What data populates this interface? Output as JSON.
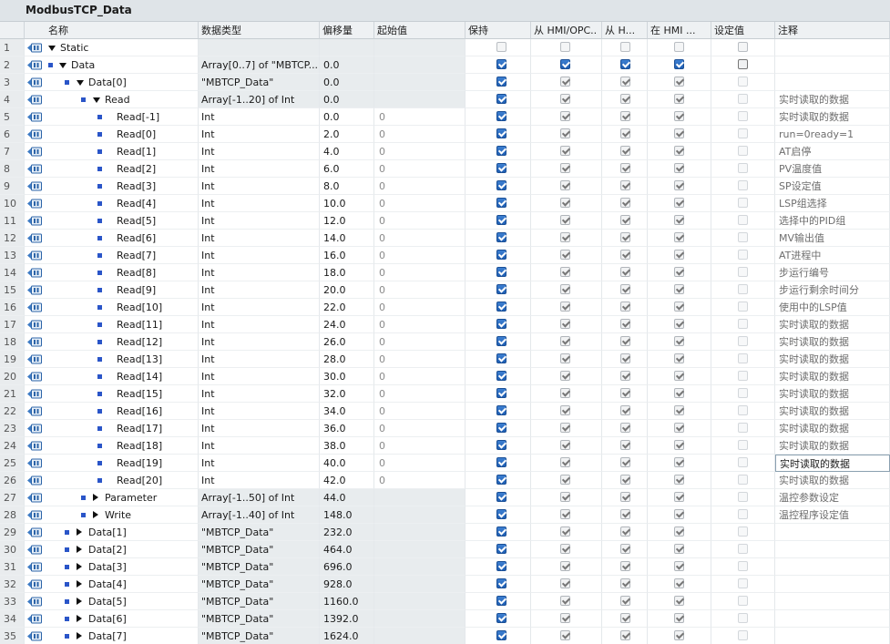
{
  "window_title": "ModbusTCP_Data",
  "headers": {
    "name": "名称",
    "type": "数据类型",
    "offset": "偏移量",
    "start": "起始值",
    "retain": "保持",
    "accessible": "从 HMI/OPC..",
    "writable": "从 H...",
    "visible": "在 HMI ...",
    "setpoint": "设定值",
    "comment": "注释"
  },
  "rows": [
    {
      "idx": "1",
      "level": 0,
      "tri": "down",
      "sq": false,
      "name": "Static",
      "type": "",
      "offset": "",
      "start": "",
      "ret": "off",
      "acc": "off",
      "wri": "off",
      "vis": "off",
      "set": "off",
      "comment": "",
      "gray": true
    },
    {
      "idx": "2",
      "level": 0,
      "tri": "down",
      "sq": true,
      "name": "Data",
      "type": "Array[0..7] of \"MBTCP...",
      "offset": "0.0",
      "start": "",
      "ret": "on",
      "acc": "on",
      "wri": "on",
      "vis": "on",
      "set": "box",
      "comment": "",
      "gray": true
    },
    {
      "idx": "3",
      "level": 1,
      "tri": "down",
      "sq": true,
      "name": "Data[0]",
      "type": "\"MBTCP_Data\"",
      "offset": "0.0",
      "start": "",
      "ret": "on",
      "acc": "grayon",
      "wri": "grayon",
      "vis": "grayon",
      "set": "dis",
      "comment": "",
      "gray": true
    },
    {
      "idx": "4",
      "level": 2,
      "tri": "down",
      "sq": true,
      "name": "Read",
      "type": "Array[-1..20] of Int",
      "offset": "0.0",
      "start": "",
      "ret": "on",
      "acc": "grayon",
      "wri": "grayon",
      "vis": "grayon",
      "set": "dis",
      "comment": "实时读取的数据",
      "gray": true
    },
    {
      "idx": "5",
      "level": 3,
      "tri": "",
      "sq": true,
      "name": "Read[-1]",
      "type": "Int",
      "offset": "0.0",
      "start": "0",
      "ret": "on",
      "acc": "grayon",
      "wri": "grayon",
      "vis": "grayon",
      "set": "dis",
      "comment": "实时读取的数据",
      "gray": false
    },
    {
      "idx": "6",
      "level": 3,
      "tri": "",
      "sq": true,
      "name": "Read[0]",
      "type": "Int",
      "offset": "2.0",
      "start": "0",
      "ret": "on",
      "acc": "grayon",
      "wri": "grayon",
      "vis": "grayon",
      "set": "dis",
      "comment": "run=0ready=1",
      "gray": false
    },
    {
      "idx": "7",
      "level": 3,
      "tri": "",
      "sq": true,
      "name": "Read[1]",
      "type": "Int",
      "offset": "4.0",
      "start": "0",
      "ret": "on",
      "acc": "grayon",
      "wri": "grayon",
      "vis": "grayon",
      "set": "dis",
      "comment": "AT启停",
      "gray": false
    },
    {
      "idx": "8",
      "level": 3,
      "tri": "",
      "sq": true,
      "name": "Read[2]",
      "type": "Int",
      "offset": "6.0",
      "start": "0",
      "ret": "on",
      "acc": "grayon",
      "wri": "grayon",
      "vis": "grayon",
      "set": "dis",
      "comment": "PV温度值",
      "gray": false
    },
    {
      "idx": "9",
      "level": 3,
      "tri": "",
      "sq": true,
      "name": "Read[3]",
      "type": "Int",
      "offset": "8.0",
      "start": "0",
      "ret": "on",
      "acc": "grayon",
      "wri": "grayon",
      "vis": "grayon",
      "set": "dis",
      "comment": "SP设定值",
      "gray": false
    },
    {
      "idx": "10",
      "level": 3,
      "tri": "",
      "sq": true,
      "name": "Read[4]",
      "type": "Int",
      "offset": "10.0",
      "start": "0",
      "ret": "on",
      "acc": "grayon",
      "wri": "grayon",
      "vis": "grayon",
      "set": "dis",
      "comment": "LSP组选择",
      "gray": false
    },
    {
      "idx": "11",
      "level": 3,
      "tri": "",
      "sq": true,
      "name": "Read[5]",
      "type": "Int",
      "offset": "12.0",
      "start": "0",
      "ret": "on",
      "acc": "grayon",
      "wri": "grayon",
      "vis": "grayon",
      "set": "dis",
      "comment": "选择中的PID组",
      "gray": false
    },
    {
      "idx": "12",
      "level": 3,
      "tri": "",
      "sq": true,
      "name": "Read[6]",
      "type": "Int",
      "offset": "14.0",
      "start": "0",
      "ret": "on",
      "acc": "grayon",
      "wri": "grayon",
      "vis": "grayon",
      "set": "dis",
      "comment": "MV输出值",
      "gray": false
    },
    {
      "idx": "13",
      "level": 3,
      "tri": "",
      "sq": true,
      "name": "Read[7]",
      "type": "Int",
      "offset": "16.0",
      "start": "0",
      "ret": "on",
      "acc": "grayon",
      "wri": "grayon",
      "vis": "grayon",
      "set": "dis",
      "comment": "AT进程中",
      "gray": false
    },
    {
      "idx": "14",
      "level": 3,
      "tri": "",
      "sq": true,
      "name": "Read[8]",
      "type": "Int",
      "offset": "18.0",
      "start": "0",
      "ret": "on",
      "acc": "grayon",
      "wri": "grayon",
      "vis": "grayon",
      "set": "dis",
      "comment": "步运行编号",
      "gray": false
    },
    {
      "idx": "15",
      "level": 3,
      "tri": "",
      "sq": true,
      "name": "Read[9]",
      "type": "Int",
      "offset": "20.0",
      "start": "0",
      "ret": "on",
      "acc": "grayon",
      "wri": "grayon",
      "vis": "grayon",
      "set": "dis",
      "comment": "步运行剩余时间分",
      "gray": false
    },
    {
      "idx": "16",
      "level": 3,
      "tri": "",
      "sq": true,
      "name": "Read[10]",
      "type": "Int",
      "offset": "22.0",
      "start": "0",
      "ret": "on",
      "acc": "grayon",
      "wri": "grayon",
      "vis": "grayon",
      "set": "dis",
      "comment": "使用中的LSP值",
      "gray": false
    },
    {
      "idx": "17",
      "level": 3,
      "tri": "",
      "sq": true,
      "name": "Read[11]",
      "type": "Int",
      "offset": "24.0",
      "start": "0",
      "ret": "on",
      "acc": "grayon",
      "wri": "grayon",
      "vis": "grayon",
      "set": "dis",
      "comment": "实时读取的数据",
      "gray": false
    },
    {
      "idx": "18",
      "level": 3,
      "tri": "",
      "sq": true,
      "name": "Read[12]",
      "type": "Int",
      "offset": "26.0",
      "start": "0",
      "ret": "on",
      "acc": "grayon",
      "wri": "grayon",
      "vis": "grayon",
      "set": "dis",
      "comment": "实时读取的数据",
      "gray": false
    },
    {
      "idx": "19",
      "level": 3,
      "tri": "",
      "sq": true,
      "name": "Read[13]",
      "type": "Int",
      "offset": "28.0",
      "start": "0",
      "ret": "on",
      "acc": "grayon",
      "wri": "grayon",
      "vis": "grayon",
      "set": "dis",
      "comment": "实时读取的数据",
      "gray": false
    },
    {
      "idx": "20",
      "level": 3,
      "tri": "",
      "sq": true,
      "name": "Read[14]",
      "type": "Int",
      "offset": "30.0",
      "start": "0",
      "ret": "on",
      "acc": "grayon",
      "wri": "grayon",
      "vis": "grayon",
      "set": "dis",
      "comment": "实时读取的数据",
      "gray": false
    },
    {
      "idx": "21",
      "level": 3,
      "tri": "",
      "sq": true,
      "name": "Read[15]",
      "type": "Int",
      "offset": "32.0",
      "start": "0",
      "ret": "on",
      "acc": "grayon",
      "wri": "grayon",
      "vis": "grayon",
      "set": "dis",
      "comment": "实时读取的数据",
      "gray": false
    },
    {
      "idx": "22",
      "level": 3,
      "tri": "",
      "sq": true,
      "name": "Read[16]",
      "type": "Int",
      "offset": "34.0",
      "start": "0",
      "ret": "on",
      "acc": "grayon",
      "wri": "grayon",
      "vis": "grayon",
      "set": "dis",
      "comment": "实时读取的数据",
      "gray": false
    },
    {
      "idx": "23",
      "level": 3,
      "tri": "",
      "sq": true,
      "name": "Read[17]",
      "type": "Int",
      "offset": "36.0",
      "start": "0",
      "ret": "on",
      "acc": "grayon",
      "wri": "grayon",
      "vis": "grayon",
      "set": "dis",
      "comment": "实时读取的数据",
      "gray": false
    },
    {
      "idx": "24",
      "level": 3,
      "tri": "",
      "sq": true,
      "name": "Read[18]",
      "type": "Int",
      "offset": "38.0",
      "start": "0",
      "ret": "on",
      "acc": "grayon",
      "wri": "grayon",
      "vis": "grayon",
      "set": "dis",
      "comment": "实时读取的数据",
      "gray": false
    },
    {
      "idx": "25",
      "level": 3,
      "tri": "",
      "sq": true,
      "name": "Read[19]",
      "type": "Int",
      "offset": "40.0",
      "start": "0",
      "ret": "on",
      "acc": "grayon",
      "wri": "grayon",
      "vis": "grayon",
      "set": "dis",
      "comment": "实时读取的数据",
      "gray": false,
      "editing": true
    },
    {
      "idx": "26",
      "level": 3,
      "tri": "",
      "sq": true,
      "name": "Read[20]",
      "type": "Int",
      "offset": "42.0",
      "start": "0",
      "ret": "on",
      "acc": "grayon",
      "wri": "grayon",
      "vis": "grayon",
      "set": "dis",
      "comment": "实时读取的数据",
      "gray": false
    },
    {
      "idx": "27",
      "level": 2,
      "tri": "right",
      "sq": true,
      "name": "Parameter",
      "type": "Array[-1..50] of Int",
      "offset": "44.0",
      "start": "",
      "ret": "on",
      "acc": "grayon",
      "wri": "grayon",
      "vis": "grayon",
      "set": "dis",
      "comment": "温控参数设定",
      "gray": true
    },
    {
      "idx": "28",
      "level": 2,
      "tri": "right",
      "sq": true,
      "name": "Write",
      "type": "Array[-1..40] of Int",
      "offset": "148.0",
      "start": "",
      "ret": "on",
      "acc": "grayon",
      "wri": "grayon",
      "vis": "grayon",
      "set": "dis",
      "comment": "温控程序设定值",
      "gray": true
    },
    {
      "idx": "29",
      "level": 1,
      "tri": "right",
      "sq": true,
      "name": "Data[1]",
      "type": "\"MBTCP_Data\"",
      "offset": "232.0",
      "start": "",
      "ret": "on",
      "acc": "grayon",
      "wri": "grayon",
      "vis": "grayon",
      "set": "dis",
      "comment": "",
      "gray": true
    },
    {
      "idx": "30",
      "level": 1,
      "tri": "right",
      "sq": true,
      "name": "Data[2]",
      "type": "\"MBTCP_Data\"",
      "offset": "464.0",
      "start": "",
      "ret": "on",
      "acc": "grayon",
      "wri": "grayon",
      "vis": "grayon",
      "set": "dis",
      "comment": "",
      "gray": true
    },
    {
      "idx": "31",
      "level": 1,
      "tri": "right",
      "sq": true,
      "name": "Data[3]",
      "type": "\"MBTCP_Data\"",
      "offset": "696.0",
      "start": "",
      "ret": "on",
      "acc": "grayon",
      "wri": "grayon",
      "vis": "grayon",
      "set": "dis",
      "comment": "",
      "gray": true
    },
    {
      "idx": "32",
      "level": 1,
      "tri": "right",
      "sq": true,
      "name": "Data[4]",
      "type": "\"MBTCP_Data\"",
      "offset": "928.0",
      "start": "",
      "ret": "on",
      "acc": "grayon",
      "wri": "grayon",
      "vis": "grayon",
      "set": "dis",
      "comment": "",
      "gray": true
    },
    {
      "idx": "33",
      "level": 1,
      "tri": "right",
      "sq": true,
      "name": "Data[5]",
      "type": "\"MBTCP_Data\"",
      "offset": "1160.0",
      "start": "",
      "ret": "on",
      "acc": "grayon",
      "wri": "grayon",
      "vis": "grayon",
      "set": "dis",
      "comment": "",
      "gray": true
    },
    {
      "idx": "34",
      "level": 1,
      "tri": "right",
      "sq": true,
      "name": "Data[6]",
      "type": "\"MBTCP_Data\"",
      "offset": "1392.0",
      "start": "",
      "ret": "on",
      "acc": "grayon",
      "wri": "grayon",
      "vis": "grayon",
      "set": "dis",
      "comment": "",
      "gray": true
    },
    {
      "idx": "35",
      "level": 1,
      "tri": "right",
      "sq": true,
      "name": "Data[7]",
      "type": "\"MBTCP_Data\"",
      "offset": "1624.0",
      "start": "",
      "ret": "on",
      "acc": "grayon",
      "wri": "grayon",
      "vis": "grayon",
      "set": "dis",
      "comment": "",
      "gray": true
    }
  ]
}
